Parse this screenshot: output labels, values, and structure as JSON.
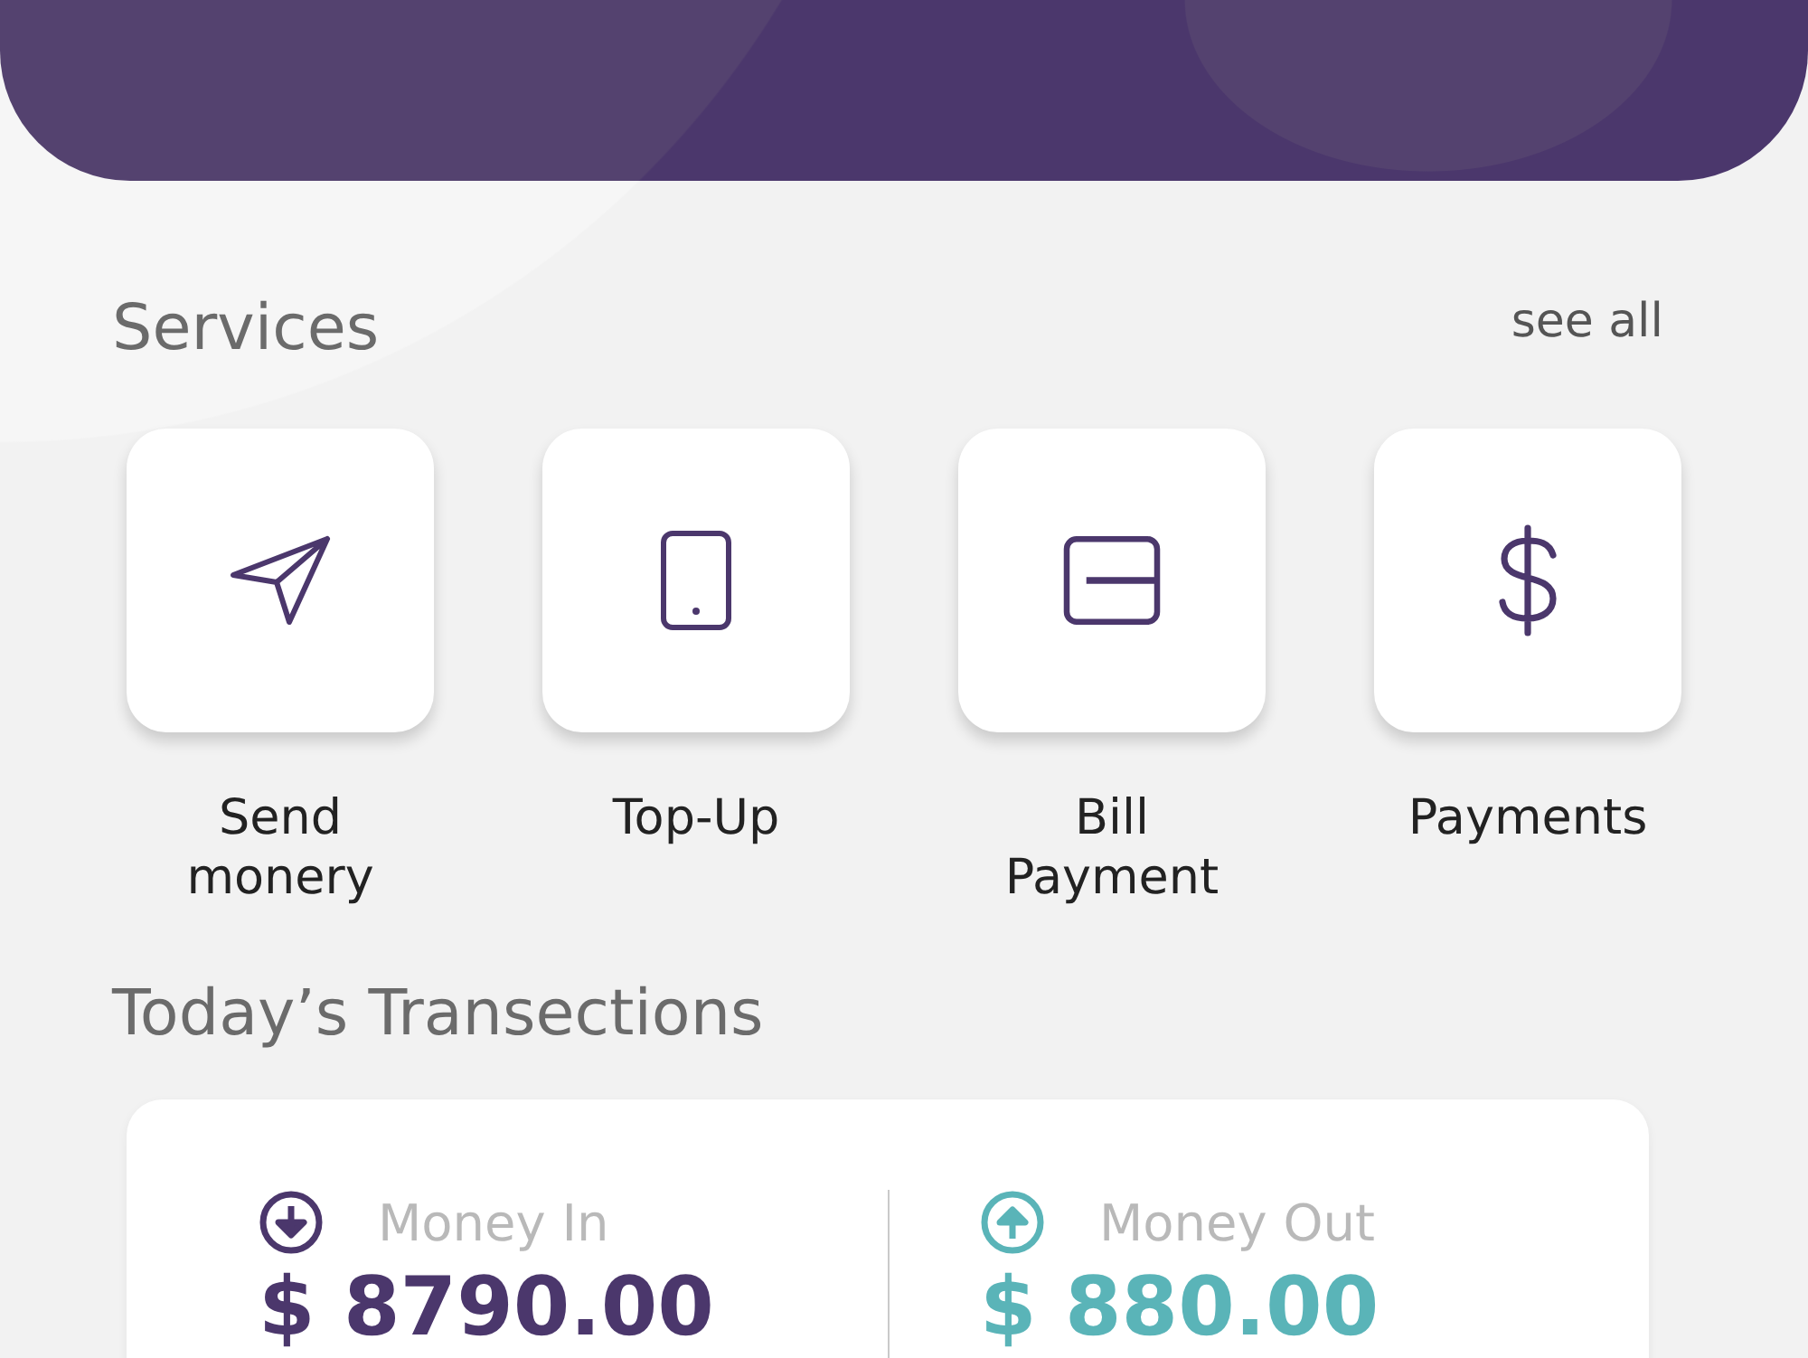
{
  "services": {
    "title": "Services",
    "see_all": "see all",
    "items": [
      {
        "kind": "send",
        "label": "Send monery"
      },
      {
        "kind": "top_up",
        "label": "Top-Up"
      },
      {
        "kind": "bill",
        "label": "Bill Payment"
      },
      {
        "kind": "payment",
        "label": "Payments"
      }
    ]
  },
  "transactions": {
    "title": "Today’s Transections",
    "items": [
      {
        "kind": "in",
        "label": "Money In",
        "amount": "$ 8790.00",
        "color": "#4b376c"
      },
      {
        "kind": "out",
        "label": "Money Out",
        "amount": "$ 880.00",
        "color": "#5ab4b8"
      }
    ]
  }
}
